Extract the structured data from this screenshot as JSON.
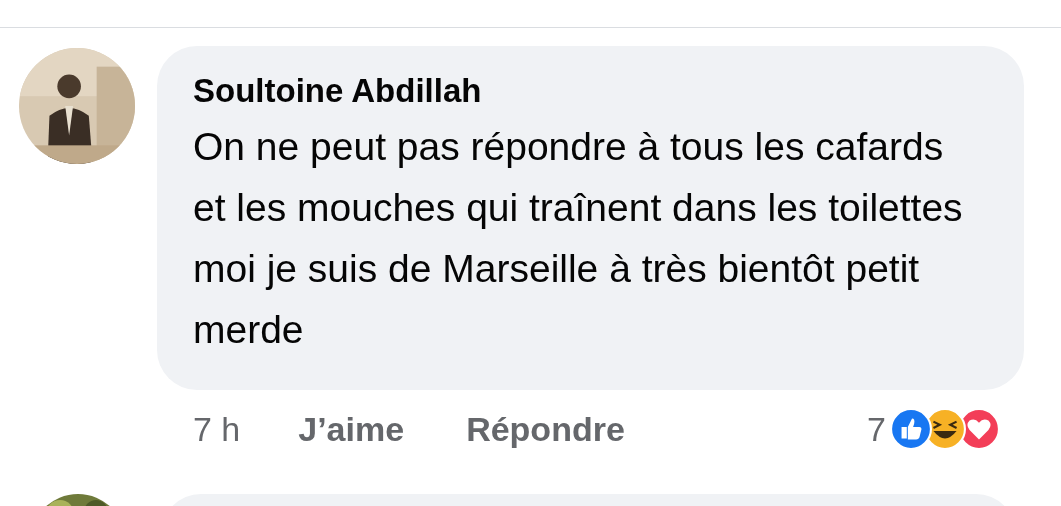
{
  "comments": [
    {
      "author": "Soultoine Abdillah",
      "text": "On ne peut pas répondre à tous les cafards et les mouches qui traînent dans les toilettes moi je suis de Marseille à très bientôt petit merde",
      "time": "7 h",
      "actions": [
        "J’aime",
        "Répondre"
      ],
      "reaction_count": "7",
      "reactions": [
        {
          "kind": "like"
        },
        {
          "kind": "haha"
        },
        {
          "kind": "love"
        }
      ]
    }
  ]
}
